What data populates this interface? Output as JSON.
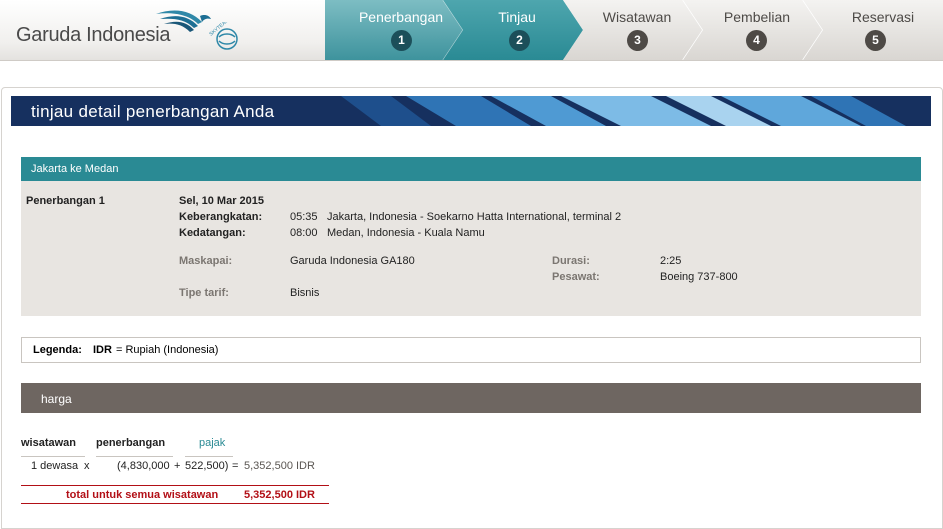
{
  "brand": {
    "name": "Garuda Indonesia",
    "skyteam_text": "SKYTEAM"
  },
  "steps": [
    {
      "label": "Penerbangan",
      "number": "1",
      "state": "completed"
    },
    {
      "label": "Tinjau",
      "number": "2",
      "state": "current"
    },
    {
      "label": "Wisatawan",
      "number": "3",
      "state": "upcoming"
    },
    {
      "label": "Pembelian",
      "number": "4",
      "state": "upcoming"
    },
    {
      "label": "Reservasi",
      "number": "5",
      "state": "upcoming"
    }
  ],
  "page_title": "tinjau detail penerbangan Anda",
  "route": {
    "title": "Jakarta ke Medan",
    "flight_label": "Penerbangan 1",
    "date": "Sel, 10 Mar 2015",
    "departure_label": "Keberangkatan:",
    "departure_time": "05:35",
    "departure_place": "Jakarta, Indonesia - Soekarno Hatta International, terminal 2",
    "arrival_label": "Kedatangan:",
    "arrival_time": "08:00",
    "arrival_place": "Medan, Indonesia - Kuala Namu",
    "carrier_label": "Maskapai:",
    "carrier_value": "Garuda Indonesia GA180",
    "fare_label": "Tipe tarif:",
    "fare_value": "Bisnis",
    "duration_label": "Durasi:",
    "duration_value": "2:25",
    "aircraft_label": "Pesawat:",
    "aircraft_value": "Boeing 737-800"
  },
  "legend": {
    "label": "Legenda:",
    "code": "IDR",
    "desc": "= Rupiah (Indonesia)"
  },
  "price": {
    "section_title": "harga",
    "headers": {
      "travellers": "wisatawan",
      "flight": "penerbangan",
      "tax": "pajak"
    },
    "row": {
      "travellers": "1 dewasa",
      "times": "x",
      "flight": "(4,830,000",
      "plus": "+",
      "tax": "522,500)",
      "equals": "=",
      "subtotal": "5,352,500 IDR"
    },
    "total_label": "total untuk semua wisatawan",
    "total_value": "5,352,500 IDR"
  },
  "colors": {
    "teal": "#2a8a94",
    "navy": "#16305f",
    "taupe": "#6e6661",
    "red": "#b20f16"
  }
}
